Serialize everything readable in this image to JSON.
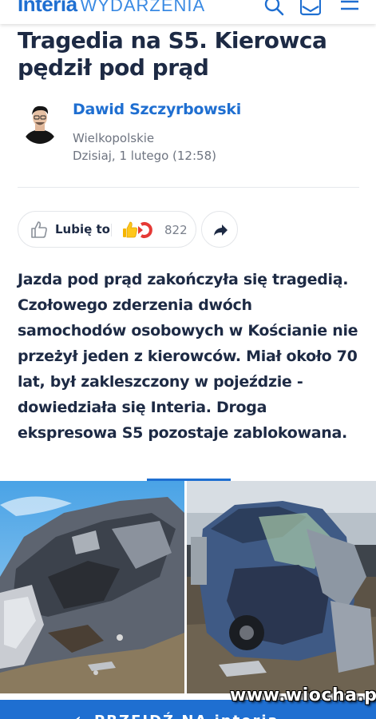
{
  "header": {
    "logo_text": "Interia",
    "section_text": "WYDARZENIA",
    "icons": [
      "search-icon",
      "mail-icon",
      "menu-icon"
    ],
    "brand_color": "#1f6fd1"
  },
  "article": {
    "title": "Tragedia na S5. Kierowca pędził pod prąd",
    "author": {
      "name": "Dawid Szczyrbowski",
      "region": "Wielkopolskie",
      "date": "Dzisiaj, 1 lutego (12:58)"
    },
    "actions": {
      "like_label": "Lubię to",
      "reaction_count": "822",
      "share_icon": "share-arrow-icon"
    },
    "lead": "Jazda pod prąd zakończyła się tragedią. Czołowego zderzenia dwóch samochodów osobowych w Kościanie nie przeżył jeden z kierowców. Miał około 70 lat, był zakleszczony w pojeździe - dowiedziała się Interia. Droga ekspresowa S5 pozostaje zablokowana."
  },
  "bottom_banner": {
    "cta": "PRZEJDŹ NA",
    "logo": "interia"
  },
  "watermark": "www.wiocha.pl"
}
